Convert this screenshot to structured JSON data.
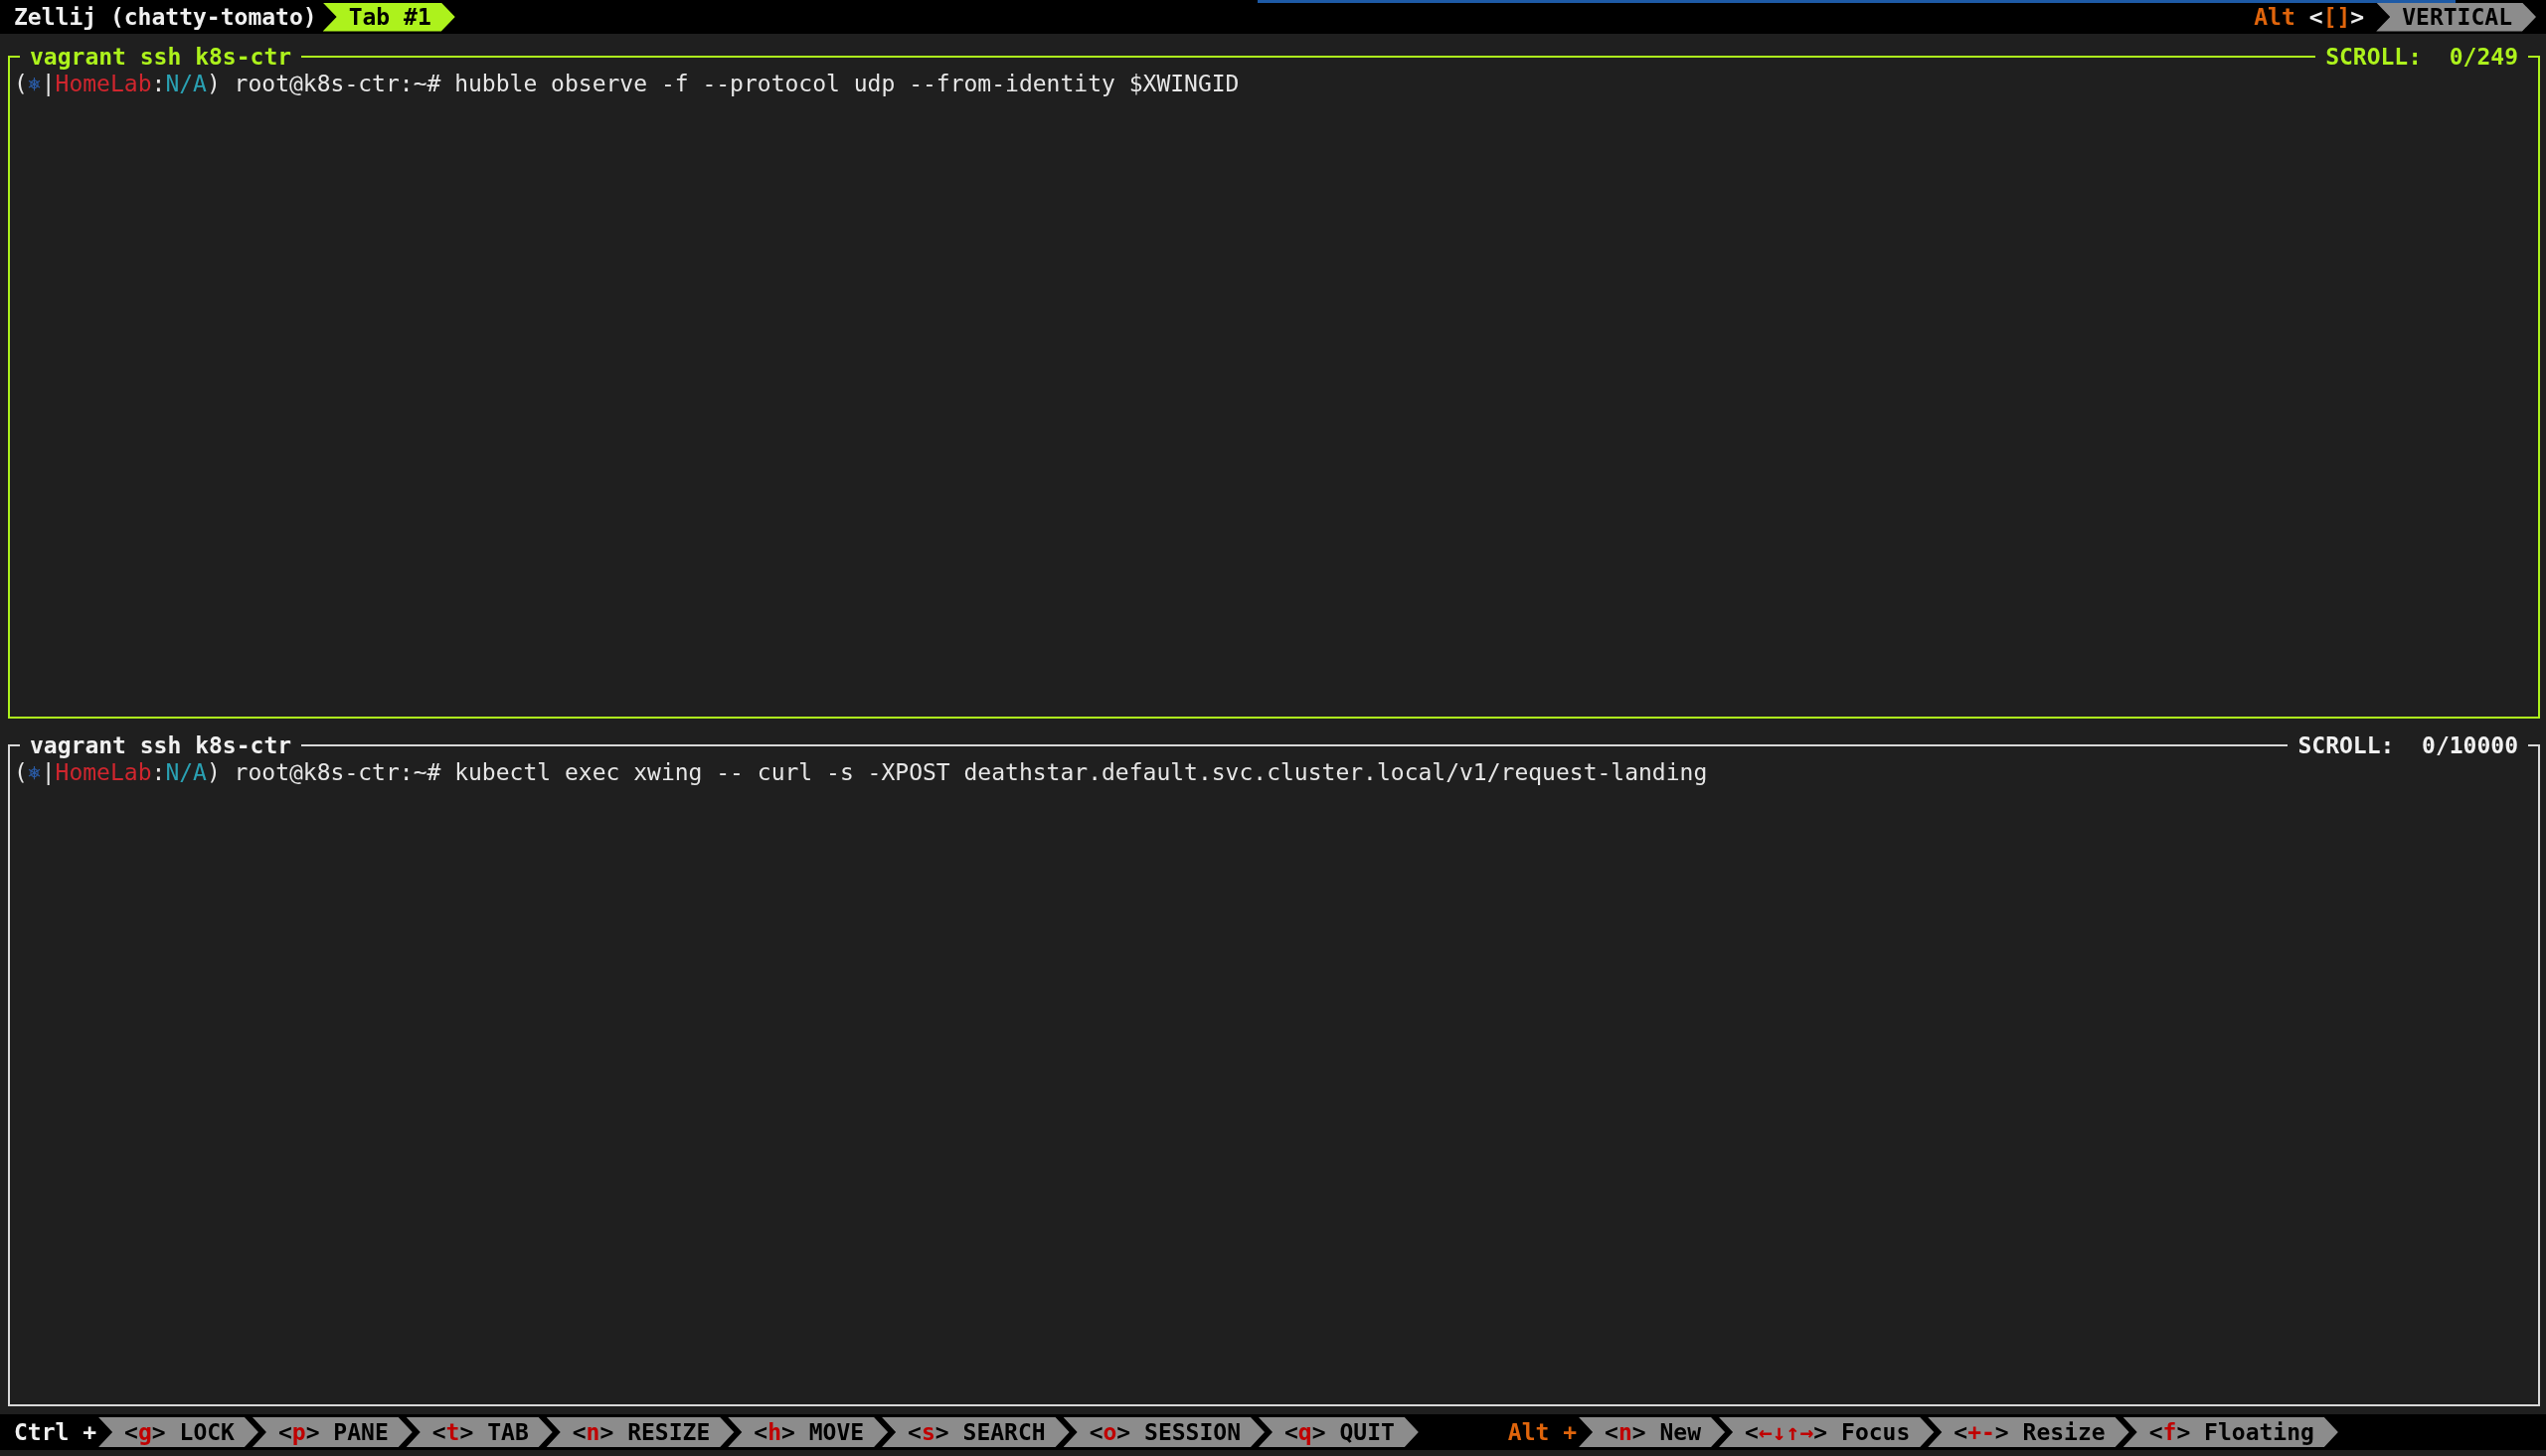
{
  "tab_bar": {
    "session": "Zellij (chatty-tomato)",
    "tabs": [
      {
        "label": "Tab #1",
        "selected": true
      }
    ],
    "swap_layout": {
      "modifier": "Alt",
      "open": "<",
      "key": "[]",
      "close": ">"
    },
    "layout": "VERTICAL"
  },
  "panes": [
    {
      "title": "vagrant ssh k8s-ctr",
      "focused": true,
      "scroll": "SCROLL:  0/249",
      "lines": [
        [
          {
            "kind": "plain",
            "text": "("
          },
          {
            "kind": "icon",
            "text": "⎈"
          },
          {
            "kind": "plain",
            "text": "|"
          },
          {
            "kind": "context",
            "text": "HomeLab"
          },
          {
            "kind": "plain",
            "text": ":"
          },
          {
            "kind": "namespace",
            "text": "N/A"
          },
          {
            "kind": "plain",
            "text": ") root@k8s-ctr:~# hubble observe -f --protocol udp --from-identity $XWINGID"
          }
        ]
      ]
    },
    {
      "title": "vagrant ssh k8s-ctr",
      "focused": false,
      "scroll": "SCROLL:  0/10000",
      "lines": [
        [
          {
            "kind": "plain",
            "text": "("
          },
          {
            "kind": "icon",
            "text": "⎈"
          },
          {
            "kind": "plain",
            "text": "|"
          },
          {
            "kind": "context",
            "text": "HomeLab"
          },
          {
            "kind": "plain",
            "text": ":"
          },
          {
            "kind": "namespace",
            "text": "N/A"
          },
          {
            "kind": "plain",
            "text": ") root@k8s-ctr:~# kubectl exec xwing -- curl -s -XPOST deathstar.default.svc.cluster.local/v1/request-landing"
          }
        ]
      ]
    }
  ],
  "status_bar": {
    "groups": [
      {
        "modifier": "Ctrl +",
        "keys": [
          {
            "open": "<",
            "key": "g",
            "close": ">",
            "label": "LOCK"
          },
          {
            "open": "<",
            "key": "p",
            "close": ">",
            "label": "PANE"
          },
          {
            "open": "<",
            "key": "t",
            "close": ">",
            "label": "TAB"
          },
          {
            "open": "<",
            "key": "n",
            "close": ">",
            "label": "RESIZE"
          },
          {
            "open": "<",
            "key": "h",
            "close": ">",
            "label": "MOVE"
          },
          {
            "open": "<",
            "key": "s",
            "close": ">",
            "label": "SEARCH"
          },
          {
            "open": "<",
            "key": "o",
            "close": ">",
            "label": "SESSION"
          },
          {
            "open": "<",
            "key": "q",
            "close": ">",
            "label": "QUIT"
          }
        ]
      },
      {
        "modifier": "Alt +",
        "keys": [
          {
            "open": "<",
            "key": "n",
            "close": ">",
            "label": "New"
          },
          {
            "open": "<",
            "key": "←↓↑→",
            "close": ">",
            "label": "Focus"
          },
          {
            "open": "<",
            "key": "+-",
            "close": ">",
            "label": "Resize"
          },
          {
            "open": "<",
            "key": "f",
            "close": ">",
            "label": "Floating"
          }
        ]
      }
    ]
  }
}
